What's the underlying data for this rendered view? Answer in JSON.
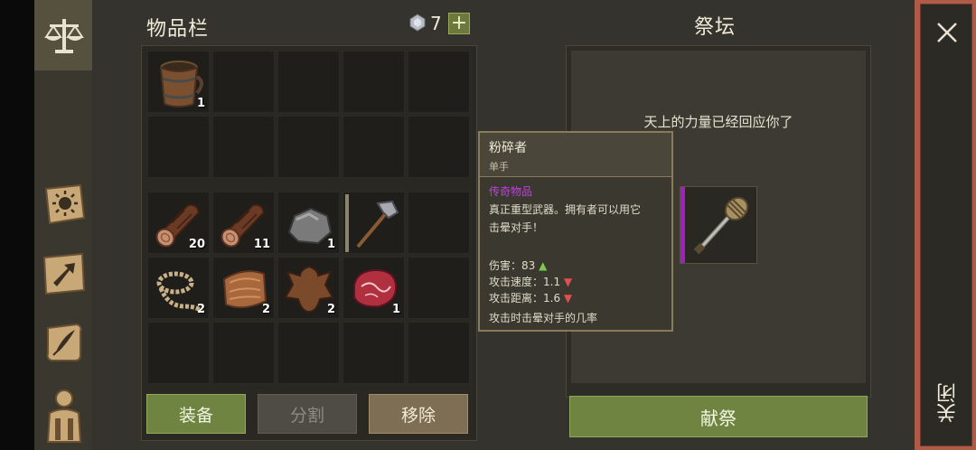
{
  "inventory": {
    "title": "物品栏",
    "gem_count": "7",
    "plus_label": "+",
    "rows": [
      [
        {
          "icon": "barrel-icon",
          "count": "1"
        },
        {
          "icon": "",
          "count": ""
        },
        {
          "icon": "",
          "count": ""
        },
        {
          "icon": "",
          "count": ""
        },
        {
          "icon": "",
          "count": ""
        }
      ],
      [
        {
          "icon": "",
          "count": ""
        },
        {
          "icon": "",
          "count": ""
        },
        {
          "icon": "",
          "count": ""
        },
        {
          "icon": "",
          "count": ""
        },
        {
          "icon": "",
          "count": ""
        }
      ],
      [
        {
          "icon": "log-icon",
          "count": "20"
        },
        {
          "icon": "log-icon",
          "count": "11"
        },
        {
          "icon": "stone-icon",
          "count": "1"
        },
        {
          "icon": "hammer-icon",
          "count": ""
        },
        {
          "icon": "",
          "count": ""
        }
      ],
      [
        {
          "icon": "rope-icon",
          "count": "2"
        },
        {
          "icon": "hide-icon",
          "count": "2"
        },
        {
          "icon": "leather-icon",
          "count": "2"
        },
        {
          "icon": "meat-icon",
          "count": "1"
        },
        {
          "icon": "",
          "count": ""
        }
      ],
      [
        {
          "icon": "",
          "count": ""
        },
        {
          "icon": "",
          "count": ""
        },
        {
          "icon": "",
          "count": ""
        },
        {
          "icon": "",
          "count": ""
        },
        {
          "icon": "",
          "count": ""
        }
      ]
    ],
    "buttons": {
      "equip": "装备",
      "split": "分割",
      "remove": "移除"
    }
  },
  "altar": {
    "title": "祭坛",
    "message": "天上的力量已经回应你了",
    "item_icon": "mace-icon",
    "offer_button": "献祭"
  },
  "tooltip": {
    "name": "粉碎者",
    "type": "单手",
    "rarity": "传奇物品",
    "desc1": "真正重型武器。拥有者可以用它",
    "desc2": "击晕对手！",
    "damage": "伤害：83",
    "attack_speed": "攻击速度：1.1",
    "attack_range": "攻击距离：1.6",
    "stun": "攻击时击晕对手的几率"
  },
  "close_label": "关闭",
  "colors": {
    "legendary": "#c040e0",
    "up": "#7ec850",
    "down": "#e05050",
    "accent": "#6b7a3c"
  }
}
